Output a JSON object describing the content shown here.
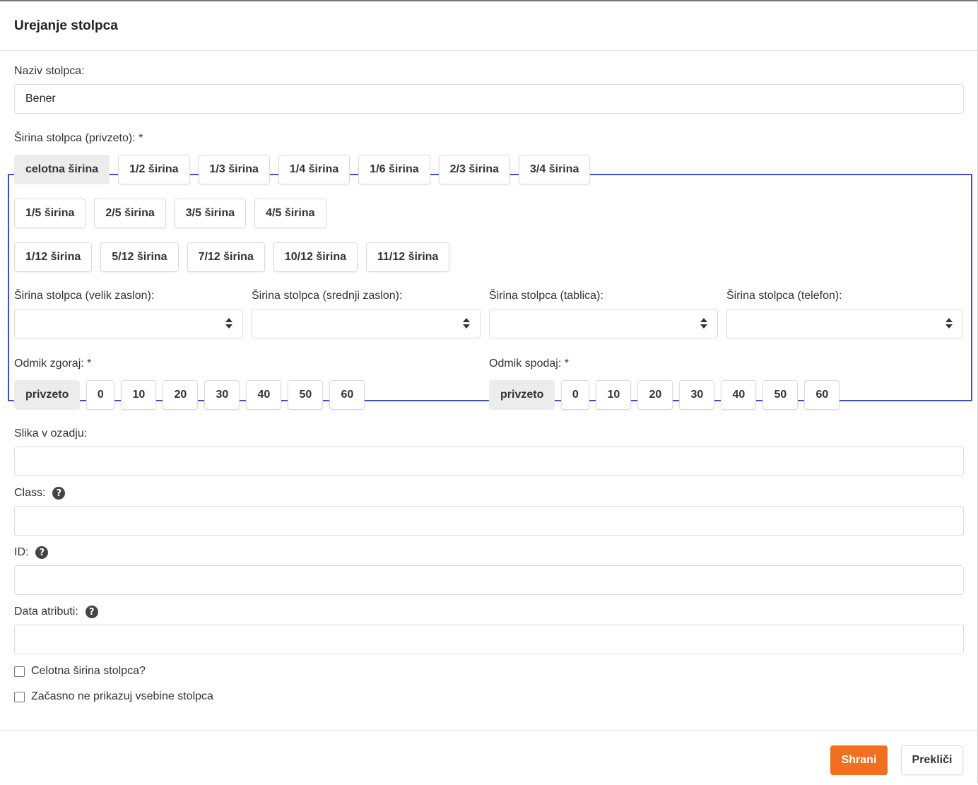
{
  "dialog": {
    "title": "Urejanje stolpca"
  },
  "column_name": {
    "label": "Naziv stolpca:",
    "value": "Bener"
  },
  "column_width": {
    "label": "Širina stolpca (privzeto): *",
    "row1": [
      "celotna širina",
      "1/2 širina",
      "1/3 širina",
      "1/4 širina",
      "1/6 širina",
      "2/3 širina",
      "3/4 širina"
    ],
    "row2": [
      "1/5 širina",
      "2/5 širina",
      "3/5 širina",
      "4/5 širina"
    ],
    "row3": [
      "1/12 širina",
      "5/12 širina",
      "7/12 širina",
      "10/12 širina",
      "11/12 širina"
    ],
    "selected": "celotna širina"
  },
  "responsive_widths": [
    {
      "label": "Širina stolpca (velik zaslon):",
      "value": ""
    },
    {
      "label": "Širina stolpca (srednji zaslon):",
      "value": ""
    },
    {
      "label": "Širina stolpca (tablica):",
      "value": ""
    },
    {
      "label": "Širina stolpca (telefon):",
      "value": ""
    }
  ],
  "margin_top": {
    "label": "Odmik zgoraj: *",
    "options": [
      "privzeto",
      "0",
      "10",
      "20",
      "30",
      "40",
      "50",
      "60"
    ],
    "selected": "privzeto"
  },
  "margin_bottom": {
    "label": "Odmik spodaj: *",
    "options": [
      "privzeto",
      "0",
      "10",
      "20",
      "30",
      "40",
      "50",
      "60"
    ],
    "selected": "privzeto"
  },
  "background_image": {
    "label": "Slika v ozadju:",
    "value": ""
  },
  "class_field": {
    "label": "Class:",
    "value": "",
    "help_icon": "question-circle"
  },
  "id_field": {
    "label": "ID:",
    "value": "",
    "help_icon": "question-circle"
  },
  "data_attrs": {
    "label": "Data atributi:",
    "value": "",
    "help_icon": "question-circle"
  },
  "checkboxes": [
    {
      "label": "Celotna širina stolpca?",
      "checked": false
    },
    {
      "label": "Začasno ne prikazuj vsebine stolpca",
      "checked": false
    }
  ],
  "footer": {
    "save_label": "Shrani",
    "cancel_label": "Prekliči",
    "accent_color": "#f26f21",
    "highlight_border_color": "#3f4fc7"
  }
}
